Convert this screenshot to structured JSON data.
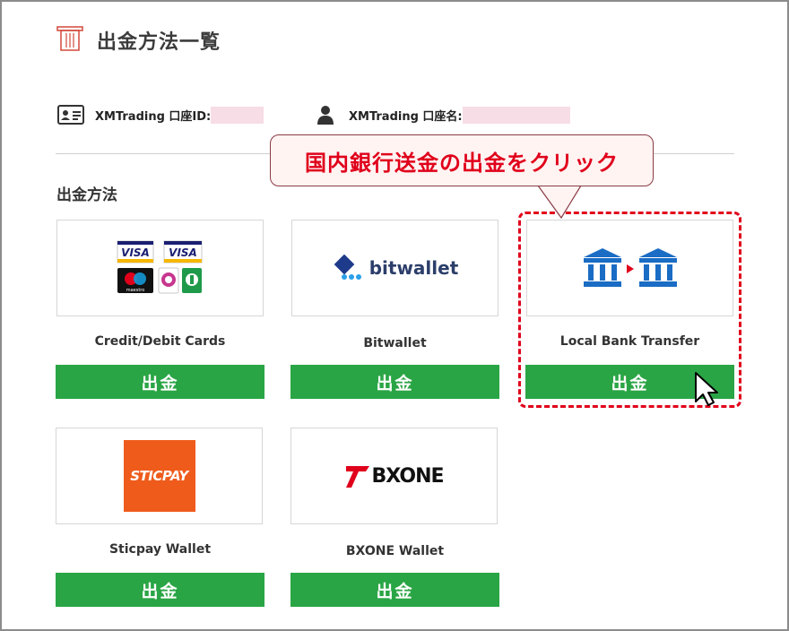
{
  "page": {
    "title": "出金方法一覧"
  },
  "account": {
    "id_label": "XMTrading 口座ID:",
    "name_label": "XMTrading 口座名:"
  },
  "section": {
    "title": "出金方法"
  },
  "methods": [
    {
      "name": "Credit/Debit Cards",
      "button": "出金",
      "logo_text": [
        "VISA",
        "VISA",
        "maestro"
      ]
    },
    {
      "name": "Bitwallet",
      "button": "出金",
      "logo_text": "bitwallet"
    },
    {
      "name": "Local Bank Transfer",
      "button": "出金"
    },
    {
      "name": "Sticpay Wallet",
      "button": "出金",
      "logo_text": "STICPAY"
    },
    {
      "name": "BXONE Wallet",
      "button": "出金",
      "logo_text": "BXONE"
    }
  ],
  "annotation": {
    "callout": "国内銀行送金の出金をクリック"
  },
  "colors": {
    "button_green": "#2aa545",
    "annotation_red": "#e0001b",
    "bank_blue": "#1a6cc4",
    "sticpay_orange": "#ef5b1b",
    "mask_pink": "#f7dde5"
  }
}
